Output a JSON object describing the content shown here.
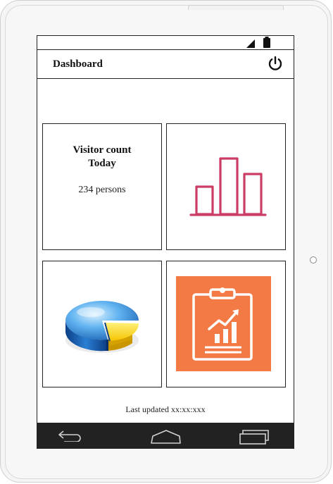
{
  "app": {
    "title": "Dashboard"
  },
  "status_bar": {
    "icons": [
      "signal-icon",
      "battery-icon"
    ]
  },
  "header": {
    "power_icon": "power-icon"
  },
  "tiles": {
    "visitor": {
      "title_line1": "Visitor count",
      "title_line2": "Today",
      "value": "234 persons"
    },
    "bar_chart_icon": "bar-chart-icon",
    "pie_chart_icon": "pie-chart-icon",
    "report_icon": "report-clipboard-icon"
  },
  "footer": {
    "text": "Last updated xx:xx:xxx"
  },
  "nav": {
    "icons": [
      "back-icon",
      "home-icon",
      "recent-apps-icon"
    ]
  },
  "colors": {
    "bar_chart": "#cc3d66",
    "report_bg": "#f47a45",
    "pie_blue": "#2a7fd4",
    "pie_yellow": "#f5c400",
    "nav_bg": "#222222"
  }
}
